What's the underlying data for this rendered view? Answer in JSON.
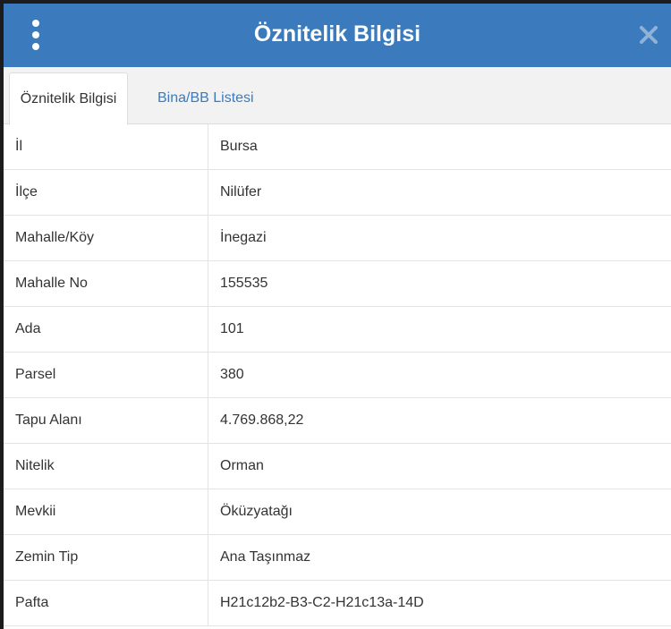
{
  "window": {
    "title": "Öznitelik Bilgisi",
    "menu_icon": "vertical-ellipsis-icon",
    "close_icon": "close-icon"
  },
  "tabs": [
    {
      "label": "Öznitelik Bilgisi",
      "active": true
    },
    {
      "label": "Bina/BB Listesi",
      "active": false
    }
  ],
  "attributes": [
    {
      "key": "İl",
      "value": "Bursa"
    },
    {
      "key": "İlçe",
      "value": "Nilüfer"
    },
    {
      "key": "Mahalle/Köy",
      "value": "İnegazi"
    },
    {
      "key": "Mahalle No",
      "value": "155535"
    },
    {
      "key": "Ada",
      "value": "101"
    },
    {
      "key": "Parsel",
      "value": "380"
    },
    {
      "key": "Tapu Alanı",
      "value": "4.769.868,22"
    },
    {
      "key": "Nitelik",
      "value": "Orman"
    },
    {
      "key": "Mevkii",
      "value": "Öküzyatağı"
    },
    {
      "key": "Zemin Tip",
      "value": "Ana Taşınmaz"
    },
    {
      "key": "Pafta",
      "value": "H21c12b2-B3-C2-H21c13a-14D"
    }
  ],
  "colors": {
    "accent": "#3b7bbd",
    "tab_text": "#3b7bbd",
    "text": "#333333"
  }
}
